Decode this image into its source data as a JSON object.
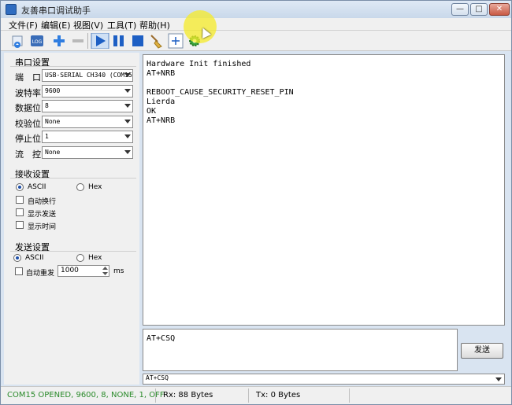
{
  "window": {
    "title": "友善串口调试助手",
    "controls": {
      "minimize": "—",
      "maximize": "□",
      "close": "✕"
    }
  },
  "menu": [
    "文件(F)",
    "编辑(E)",
    "视图(V)",
    "工具(T)",
    "帮助(H)"
  ],
  "toolbar": {
    "log_label": "LOG",
    "icons": [
      "new-session-icon",
      "log-icon",
      "add-icon",
      "remove-icon",
      "play-icon",
      "pause-icon",
      "stop-icon",
      "broom-clear-icon",
      "plus-window-icon",
      "gear-icon"
    ]
  },
  "serial_settings": {
    "title": "串口设置",
    "fields": [
      {
        "label": "端　口",
        "value": "USB-SERIAL CH340 (COM15"
      },
      {
        "label": "波特率",
        "value": "9600"
      },
      {
        "label": "数据位",
        "value": "8"
      },
      {
        "label": "校验位",
        "value": "None"
      },
      {
        "label": "停止位",
        "value": "1"
      },
      {
        "label": "流　控",
        "value": "None"
      }
    ]
  },
  "receive_settings": {
    "title": "接收设置",
    "ascii": "ASCII",
    "hex": "Hex",
    "options": [
      "自动换行",
      "显示发送",
      "显示时间"
    ]
  },
  "send_settings": {
    "title": "发送设置",
    "ascii": "ASCII",
    "hex": "Hex",
    "auto_resend": "自动重发",
    "interval": "1000",
    "unit": "ms"
  },
  "receive_text": "Hardware Init finished\nAT+NRB\n\nREBOOT_CAUSE_SECURITY_RESET_PIN\nLierda\nOK\nAT+NRB",
  "send_text": "AT+CSQ",
  "send_button": "发送",
  "history_value": "AT+CSQ",
  "status": {
    "connection": "COM15 OPENED, 9600, 8, NONE, 1, OFF",
    "rx": "Rx: 88 Bytes",
    "tx": "Tx: 0 Bytes",
    "connection_color": "#2a8a2a"
  }
}
